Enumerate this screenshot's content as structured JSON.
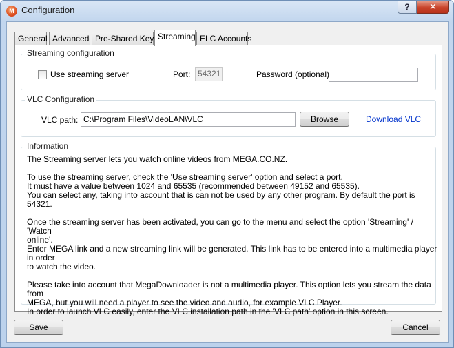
{
  "window": {
    "title": "Configuration",
    "icon": "mega-icon",
    "help_label": "?",
    "close_label": "✕"
  },
  "tabs": [
    {
      "label": "General"
    },
    {
      "label": "Advanced"
    },
    {
      "label": "Pre-Shared Keys"
    },
    {
      "label": "Streaming",
      "active": true
    },
    {
      "label": "ELC Accounts"
    }
  ],
  "streaming": {
    "group_title": "Streaming configuration",
    "use_server_label": "Use streaming server",
    "use_server_checked": false,
    "port_label": "Port:",
    "port_value": "54321",
    "password_label": "Password (optional):",
    "password_value": ""
  },
  "vlc": {
    "group_title": "VLC Configuration",
    "path_label": "VLC path:",
    "path_value": "C:\\Program Files\\VideoLAN\\VLC",
    "browse_label": "Browse",
    "download_label": "Download VLC"
  },
  "information": {
    "group_title": "Information",
    "paragraphs": [
      [
        "The Streaming server lets you watch online videos from MEGA.CO.NZ."
      ],
      [
        "To use the streaming server, check the 'Use streaming server' option and select a port.",
        "It must have a value between 1024 and 65535 (recommended between 49152 and 65535).",
        "You can select any, taking into account that is can not be used by any other program. By default the port is 54321."
      ],
      [
        "Once the streaming server has been activated, you can go to the menu and select the option 'Streaming' / 'Watch",
        "online'.",
        "Enter MEGA link and a new streaming link will be generated. This link has to be entered into a multimedia player in order",
        "to watch the video."
      ],
      [
        "Please take into account that MegaDownloader is not a multimedia player. This option lets you stream the data from",
        "MEGA, but you will need a player to see the video and audio, for example VLC Player.",
        "In order to launch VLC easily, enter the VLC installation path in the 'VLC path' option in this screen."
      ]
    ]
  },
  "footer": {
    "save_label": "Save",
    "cancel_label": "Cancel"
  }
}
